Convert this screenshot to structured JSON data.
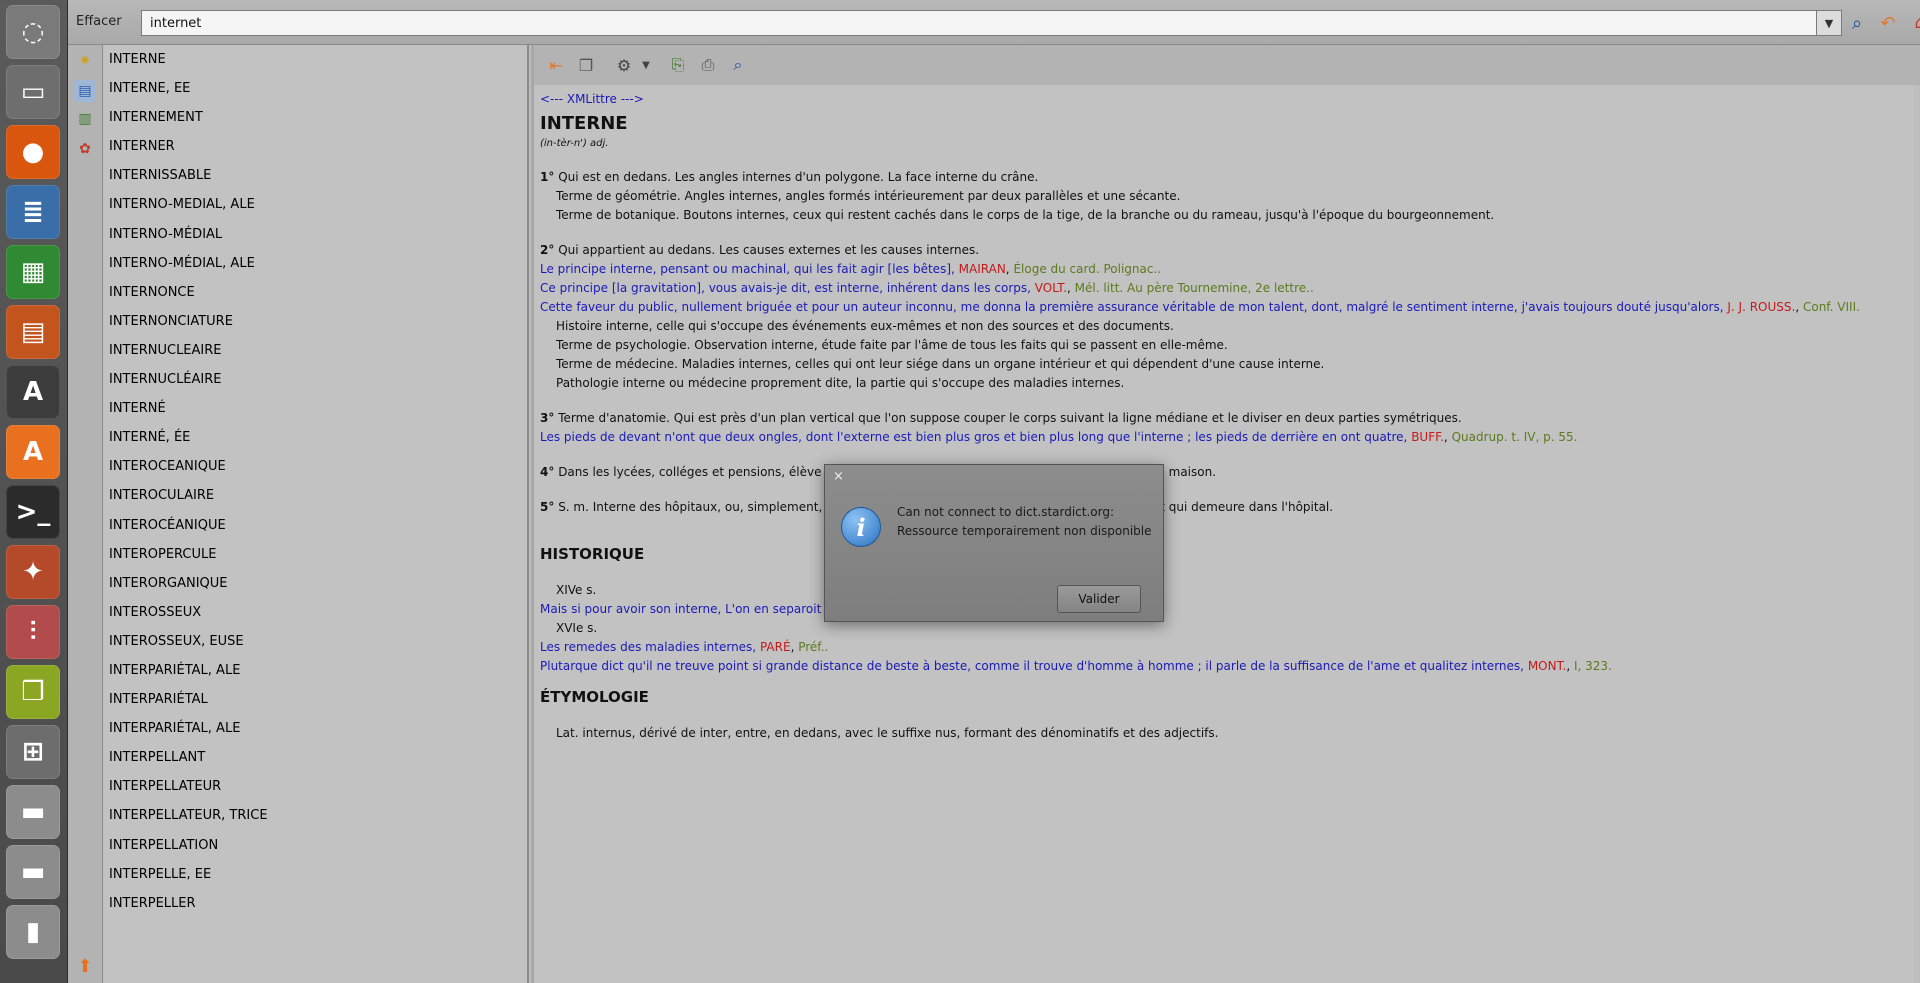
{
  "launcher": {
    "items": [
      {
        "name": "ubuntu-logo-icon",
        "glyph": "◌",
        "bg": "#7a7a7a"
      },
      {
        "name": "files-icon",
        "glyph": "▭",
        "bg": "#6e6e6e"
      },
      {
        "name": "firefox-icon",
        "glyph": "●",
        "bg": "#d9560f"
      },
      {
        "name": "writer-icon",
        "glyph": "≣",
        "bg": "#3a6ea8"
      },
      {
        "name": "calc-icon",
        "glyph": "▦",
        "bg": "#2f8a33"
      },
      {
        "name": "impress-icon",
        "glyph": "▤",
        "bg": "#c4541d"
      },
      {
        "name": "software-updater-icon",
        "glyph": "A",
        "bg": "#3c3c3c"
      },
      {
        "name": "software-center-icon",
        "glyph": "A",
        "bg": "#e8701f"
      },
      {
        "name": "terminal-icon",
        "glyph": ">_",
        "bg": "#2b2b2b"
      },
      {
        "name": "system-settings-icon",
        "glyph": "✦",
        "bg": "#b44a2a"
      },
      {
        "name": "mixer-icon",
        "glyph": "⫶",
        "bg": "#b24b4b"
      },
      {
        "name": "stardict-icon",
        "glyph": "❒",
        "bg": "#8aa623"
      },
      {
        "name": "workspace-switcher-icon",
        "glyph": "⊞",
        "bg": "#6d6d6d"
      },
      {
        "name": "drive-icon",
        "glyph": "▬",
        "bg": "#8c8c8c"
      },
      {
        "name": "drive-icon-2",
        "glyph": "▬",
        "bg": "#8c8c8c"
      },
      {
        "name": "usb-icon",
        "glyph": "▮",
        "bg": "#8c8c8c"
      }
    ]
  },
  "search": {
    "clear_label": "Effacer",
    "value": "internet"
  },
  "wordlist": [
    "INTERNE",
    "INTERNE, EE",
    "INTERNEMENT",
    "INTERNER",
    "INTERNISSABLE",
    "INTERNO-MEDIAL, ALE",
    "INTERNO-MÉDIAL",
    "INTERNO-MÉDIAL, ALE",
    "INTERNONCE",
    "INTERNONCIATURE",
    "INTERNUCLEAIRE",
    "INTERNUCLÉAIRE",
    "INTERNÉ",
    "INTERNÉ, ÉE",
    "INTEROCEANIQUE",
    "INTEROCULAIRE",
    "INTEROCÉANIQUE",
    "INTEROPERCULE",
    "INTERORGANIQUE",
    "INTEROSSEUX",
    "INTEROSSEUX, EUSE",
    "INTERPARIÉTAL, ALE",
    "INTERPARIÉTAL",
    "INTERPARIÉTAL, ALE",
    "INTERPELLANT",
    "INTERPELLATEUR",
    "INTERPELLATEUR, TRICE",
    "INTERPELLATION",
    "INTERPELLE, EE",
    "INTERPELLER"
  ],
  "article": {
    "source": "<--- XMLittre --->",
    "headword": "INTERNE",
    "pronunciation": "(in-tèr-n') adj.",
    "s1_num": "1°",
    "s1_text": "Qui est en dedans. Les angles internes d'un polygone. La face interne du crâne.",
    "s1_geo": "Terme de géométrie. Angles internes, angles formés intérieurement par deux parallèles et une sécante.",
    "s1_bot": "Terme de botanique. Boutons internes, ceux qui restent cachés dans le corps de la tige, de la branche ou du rameau, jusqu'à l'époque du bourgeonnement.",
    "s2_num": "2°",
    "s2_text": "Qui appartient au dedans. Les causes externes et les causes internes.",
    "q1_text": "Le principe interne, pensant ou machinal, qui les fait agir [les bêtes],",
    "q1_author": "MAIRAN",
    "q1_ref": "Éloge du card. Polignac..",
    "q2_text": "Ce principe [la gravitation], vous avais-je dit, est interne, inhérent dans les corps,",
    "q2_author": "VOLT.",
    "q2_ref": "Mél. litt. Au père Tournemine, 2e lettre..",
    "q3_text": "Cette faveur du public, nullement briguée et pour un auteur inconnu, me donna la première assurance véritable de mon talent, dont, malgré le sentiment interne, j'avais toujours douté jusqu'alors,",
    "q3_author": "J. J. ROUSS.",
    "q3_ref": "Conf. VIII.",
    "s2_hist": "Histoire interne, celle qui s'occupe des événements eux-mêmes et non des sources et des documents.",
    "s2_psy": "Terme de psychologie. Observation interne, étude faite par l'âme de tous les faits qui se passent en elle-même.",
    "s2_med": "Terme de médecine. Maladies internes, celles qui ont leur siége dans un organe intérieur et qui dépendent d'une cause interne.",
    "s2_path": "Pathologie interne ou médecine proprement dite, la partie qui s'occupe des maladies internes.",
    "s3_num": "3°",
    "s3_text": "Terme d'anatomie. Qui est près d'un plan vertical que l'on suppose couper le corps suivant la ligne médiane et le diviser en deux parties symétriques.",
    "q4_text": "Les pieds de devant n'ont que deux ongles, dont l'externe est bien plus gros et bien plus long que l'interne ; les pieds de derrière en ont quatre,",
    "q4_author": "BUFF.",
    "q4_ref": "Quadrup. t. IV, p. 55.",
    "s4_num": "4°",
    "s4_text": "Dans les lycées, colléges et pensions, élève",
    "s4_tail": "dans la maison.",
    "s5_num": "5°",
    "s5_text": "S. m. Interne des hôpitaux, ou, simplement,",
    "s5_tail": "t qui demeure dans l'hôpital.",
    "historique_heading": "HISTORIQUE",
    "h_c14": "XIVe s.",
    "h_q1": "Mais si pour avoir son interne, L'on en separoit",
    "h_c16": "XVIe s.",
    "h_q2_text": "Les remedes des maladies internes,",
    "h_q2_author": "PARÉ",
    "h_q2_ref": "Préf..",
    "h_q3_text": "Plutarque dict qu'il ne treuve point si grande distance de beste à beste, comme il trouve d'homme à homme ; il parle de la suffisance de l'ame et qualitez internes,",
    "h_q3_author": "MONT.",
    "h_q3_ref": "I, 323.",
    "etym_heading": "ÉTYMOLOGIE",
    "etym_text": "Lat. internus, dérivé de inter, entre, en dedans, avec le suffixe nus, formant des dénominatifs et des adjectifs."
  },
  "dialog": {
    "close": "×",
    "line1": "Can not connect to dict.stardict.org:",
    "line2": "Ressource temporairement non disponible",
    "ok_label": "Valider"
  },
  "colors": {
    "link_blue": "#1a1ab8",
    "author_red": "#c41a1a",
    "ref_olive": "#5c7a1e"
  }
}
